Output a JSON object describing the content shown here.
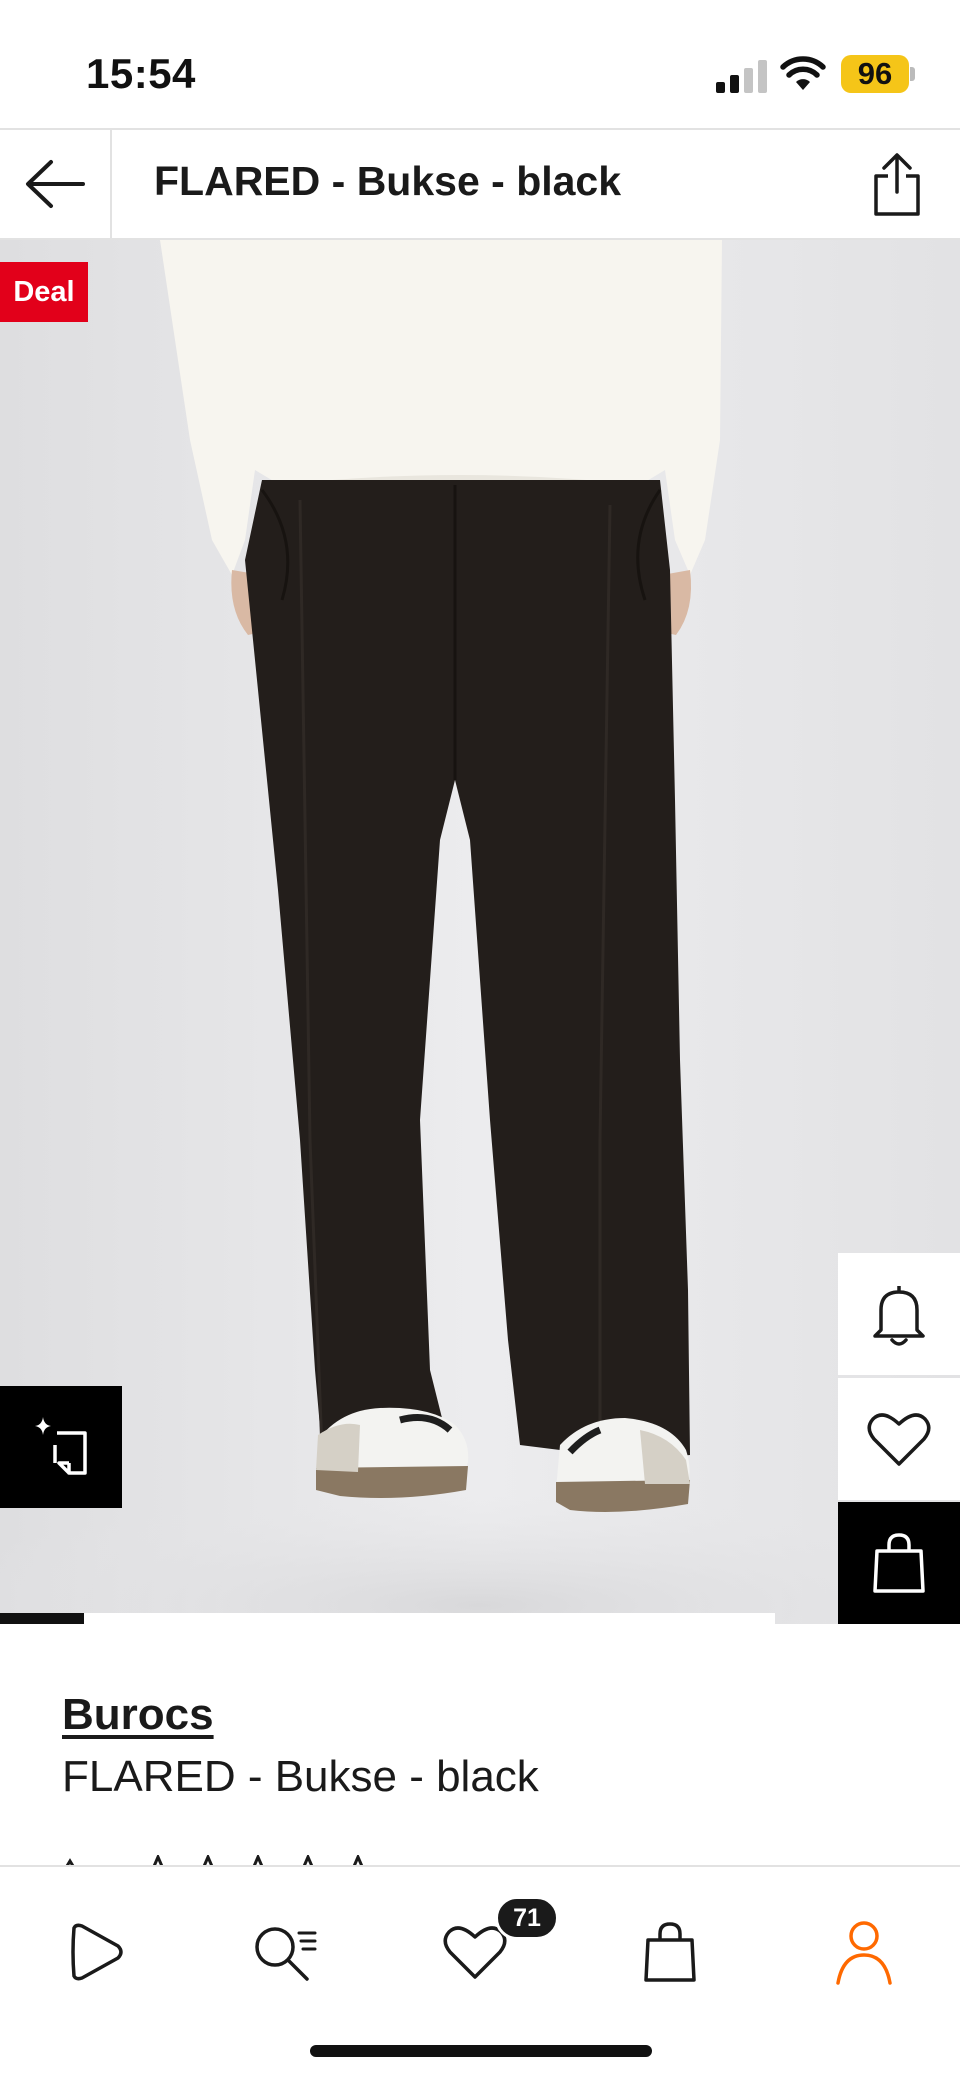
{
  "status_bar": {
    "time": "15:54",
    "battery": "96",
    "battery_color": "#f5c518"
  },
  "header": {
    "back_icon": "arrow-left-icon",
    "title": "FLARED - Bukse - black",
    "share_icon": "share-icon"
  },
  "gallery": {
    "deal_badge": "Deal",
    "deal_color": "#e2001a",
    "image_progress": 0.108,
    "buttons": {
      "notify_icon": "bell-icon",
      "wishlist_icon": "heart-icon",
      "add_to_bag_icon": "bag-icon",
      "compare_icon": "sparkle-frame-icon"
    }
  },
  "product": {
    "brand": "Burocs",
    "name": "FLARED - Bukse - black"
  },
  "bottom_nav": {
    "items": [
      {
        "icon": "play-icon",
        "name": "discover"
      },
      {
        "icon": "search-list-icon",
        "name": "search"
      },
      {
        "icon": "heart-icon",
        "name": "wishlist",
        "badge": "71"
      },
      {
        "icon": "bag-icon",
        "name": "bag"
      },
      {
        "icon": "person-icon",
        "name": "profile"
      }
    ],
    "active_color": "#ff6900"
  }
}
